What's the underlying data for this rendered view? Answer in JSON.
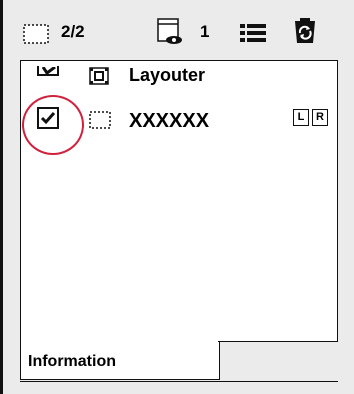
{
  "toolbar": {
    "layer_count": "2/2",
    "visible_count": "1",
    "icons": [
      "layer-frame-icon",
      "visible-layer-icon",
      "list-icon",
      "sync-icon"
    ]
  },
  "layers": [
    {
      "label": "Layouter",
      "checked": true,
      "icon": "layouter-icon"
    },
    {
      "label": "XXXXXX",
      "checked": true,
      "icon": "raster-layer-icon",
      "badges": [
        "L",
        "R"
      ]
    }
  ],
  "tab": {
    "label": "Information"
  },
  "colors": {
    "highlight": "#d0213d",
    "background": "#ebebeb"
  }
}
